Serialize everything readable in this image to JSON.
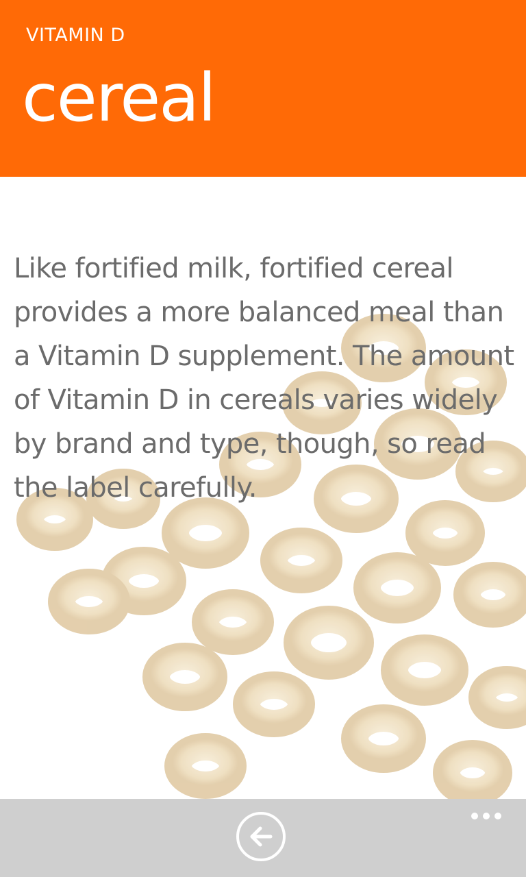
{
  "header": {
    "app_title": "VITAMIN D",
    "page_title": "cereal"
  },
  "content": {
    "body": "Like fortified milk, fortified cereal provides a more balanced meal than a Vitamin D supplement. The amount of Vitamin D in cereals varies widely by brand and type, though, so read the label carefully."
  },
  "app_bar": {
    "back_icon": "arrow-left-circle-icon",
    "more_icon": "ellipsis-icon"
  },
  "colors": {
    "accent": "#FF6A06",
    "app_bar": "#CFCFCF",
    "body_text": "#6B6B6B"
  }
}
